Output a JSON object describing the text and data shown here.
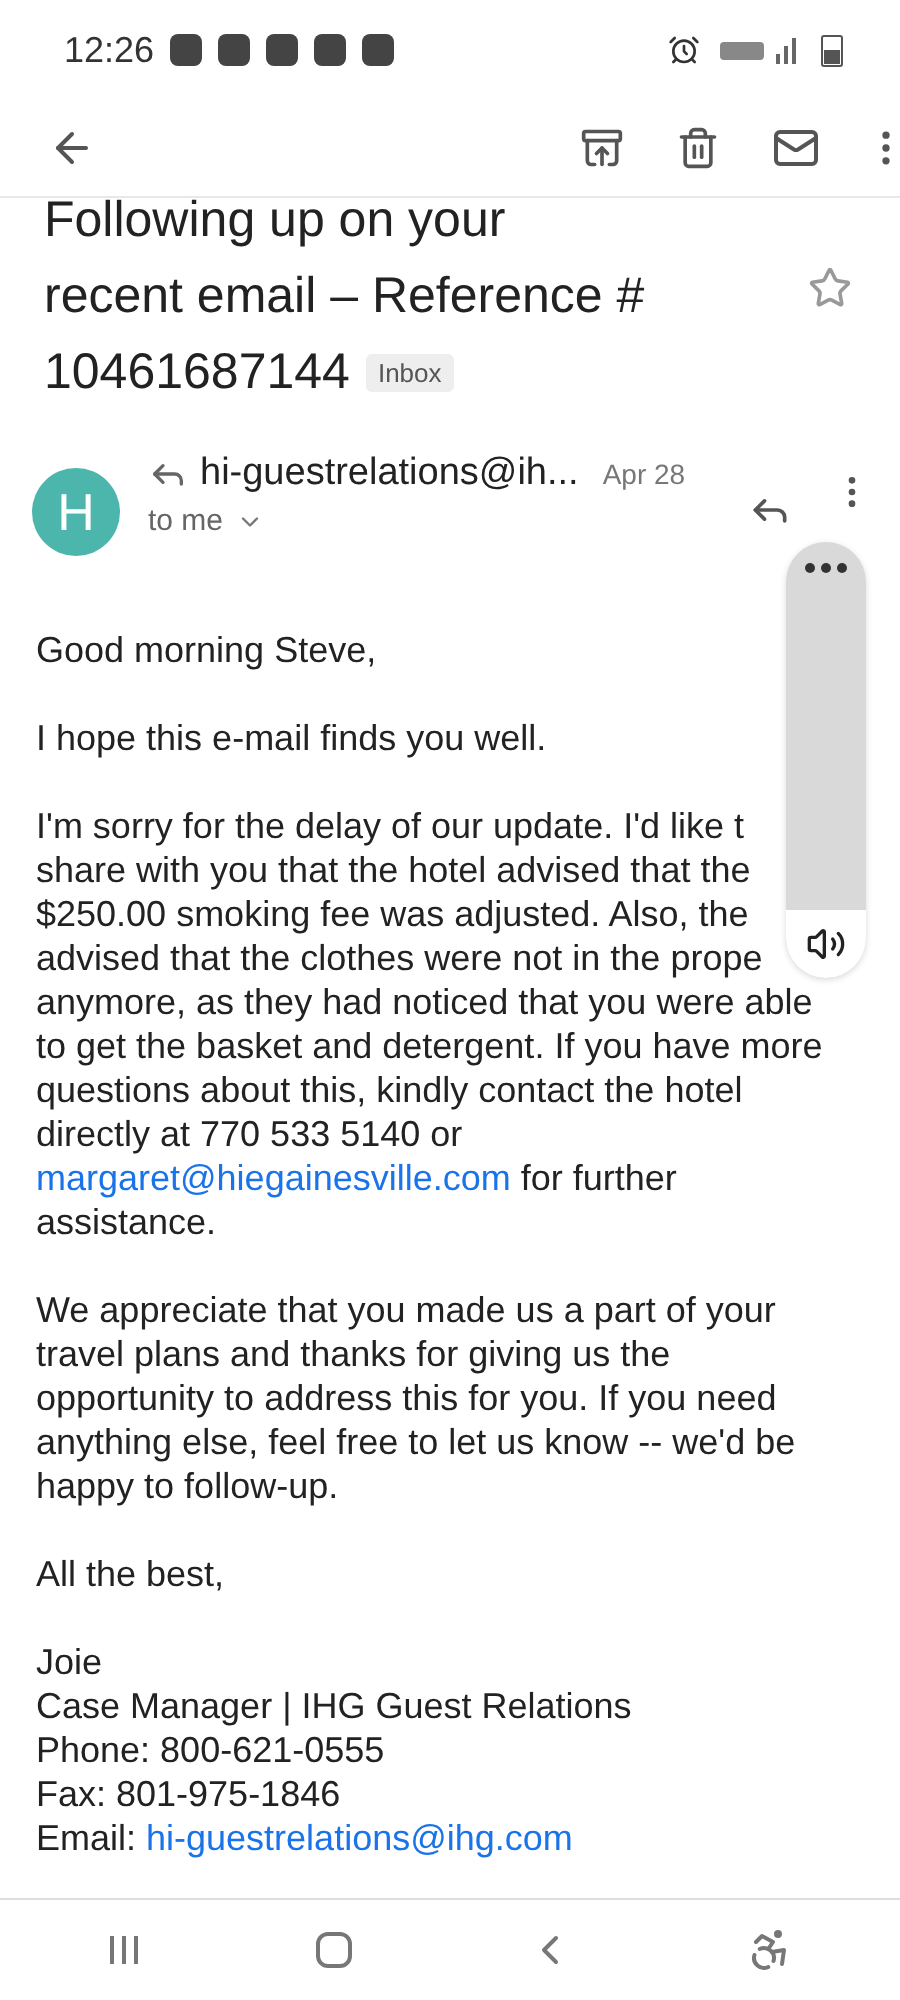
{
  "status_bar": {
    "time": "12:26"
  },
  "subject": {
    "lines": [
      "Following up on your",
      "recent email – Reference #",
      "10461687144"
    ],
    "label": "Inbox",
    "starred": false
  },
  "message": {
    "avatar": "H",
    "sender": "hi-guestrelations@ih...",
    "date": "Apr 28",
    "recipient": "to me"
  },
  "body": [
    [
      [
        {
          "text": "Good morning Steve,"
        }
      ]
    ],
    [
      [
        {
          "text": "I hope this e-mail finds you well."
        }
      ]
    ],
    [
      [
        {
          "text": "I'm sorry for the delay of our update. I'd like t"
        }
      ],
      [
        {
          "text": "share with you that the hotel advised that the"
        }
      ],
      [
        {
          "text": "$250.00 smoking fee was adjusted. Also, the"
        }
      ],
      [
        {
          "text": "advised that the clothes were not in the prope"
        }
      ],
      [
        {
          "text": "anymore, as they had noticed that you were able"
        }
      ],
      [
        {
          "text": "to get the basket and detergent. If you have more"
        }
      ],
      [
        {
          "text": "questions about this, kindly contact the hotel"
        }
      ],
      [
        {
          "text": "directly at 770 533 5140 or"
        }
      ],
      [
        {
          "text": "margaret@hiegainesville.com",
          "link": true
        },
        {
          "text": " for further"
        }
      ],
      [
        {
          "text": "assistance."
        }
      ]
    ],
    [
      [
        {
          "text": "We appreciate that you made us a part of your"
        }
      ],
      [
        {
          "text": "travel plans and thanks for giving us the"
        }
      ],
      [
        {
          "text": "opportunity to address this for you. If you need"
        }
      ],
      [
        {
          "text": "anything else, feel free to let us know -- we'd be"
        }
      ],
      [
        {
          "text": "happy to follow-up."
        }
      ]
    ],
    [
      [
        {
          "text": "All the best,"
        }
      ]
    ],
    [
      [
        {
          "text": "Joie"
        }
      ],
      [
        {
          "text": "Case Manager | IHG Guest Relations"
        }
      ],
      [
        {
          "text": "Phone: 800-621-0555"
        }
      ],
      [
        {
          "text": "Fax: 801-975-1846"
        }
      ],
      [
        {
          "text": "Email: "
        },
        {
          "text": "hi-guestrelations@ihg.com",
          "link": true
        }
      ]
    ]
  ]
}
